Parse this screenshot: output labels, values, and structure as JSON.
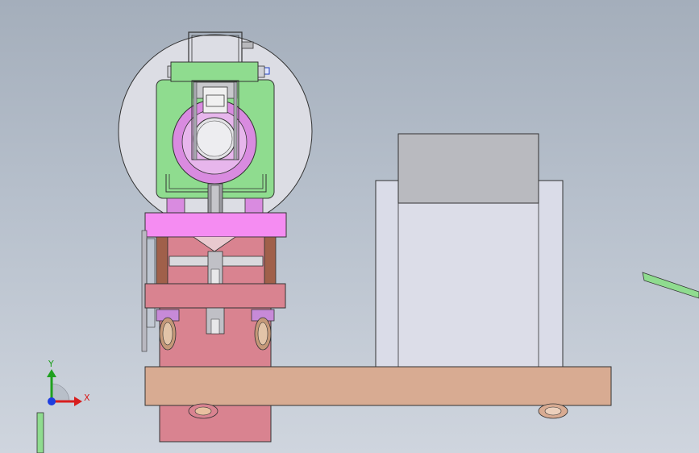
{
  "viewport": {
    "background_top": "#a4aebb",
    "background_bottom": "#cfd5de"
  },
  "triad": {
    "x_label": "X",
    "y_label": "Y",
    "x_color": "#d81e1e",
    "y_color": "#1fa01f",
    "z_color": "#1e3ee0"
  },
  "colors": {
    "drum": "#dcdde4",
    "green_frame": "#8fdc8f",
    "magenta_ring": "#d98be0",
    "pink_plate": "#f58cf2",
    "rose_body": "#d98390",
    "brown_post": "#a0604a",
    "purple_pad": "#c78ad8",
    "wood_base": "#d8ab92",
    "cabinet": "#dadce8",
    "cabinet_top": "#b9babf"
  }
}
